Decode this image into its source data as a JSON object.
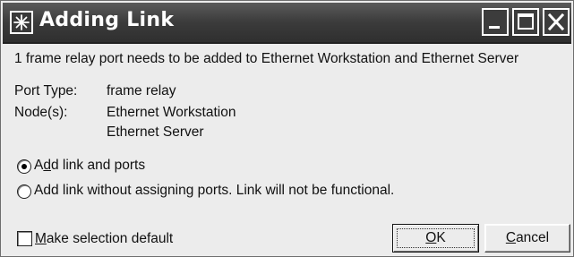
{
  "window": {
    "title": "Adding Link",
    "controls": [
      "minimize",
      "maximize",
      "close"
    ]
  },
  "message": "1 frame relay port needs to be added to Ethernet Workstation and Ethernet Server",
  "details": {
    "port_type_label": "Port Type:",
    "port_type_value": "frame relay",
    "nodes_label": "Node(s):",
    "nodes": [
      "Ethernet Workstation",
      "Ethernet Server"
    ]
  },
  "options": [
    {
      "label_mnemonic": "d",
      "label_before": "A",
      "label_after": "d link and ports",
      "selected": true
    },
    {
      "label_mnemonic": "",
      "label_before": "",
      "label_after": "Add link without assigning ports.  Link will not be functional.",
      "selected": false
    }
  ],
  "checkbox": {
    "label_mnemonic": "M",
    "label_rest": "ake selection default",
    "checked": false
  },
  "buttons": {
    "ok_mnemonic": "O",
    "ok_rest": "K",
    "cancel_mnemonic": "C",
    "cancel_rest": "ancel"
  }
}
